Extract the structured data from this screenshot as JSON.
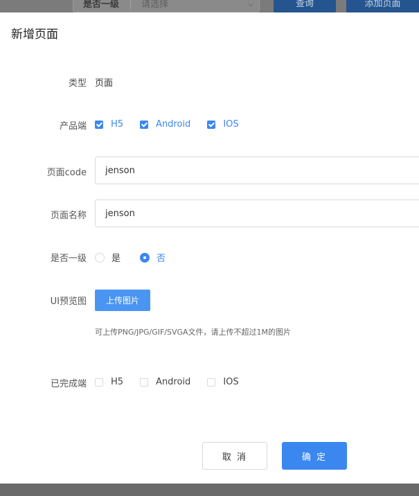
{
  "background": {
    "filter_label": "是否一级",
    "filter_placeholder": "请选择",
    "query_button": "查询",
    "add_button": "添加页面"
  },
  "modal": {
    "title": "新增页面",
    "type": {
      "label": "类型",
      "value": "页面"
    },
    "platforms": {
      "label": "产品端",
      "options": [
        {
          "label": "H5",
          "checked": true
        },
        {
          "label": "Android",
          "checked": true
        },
        {
          "label": "IOS",
          "checked": true
        }
      ]
    },
    "page_code": {
      "label": "页面code",
      "value": "jenson"
    },
    "page_name": {
      "label": "页面名称",
      "value": "jenson"
    },
    "is_top_level": {
      "label": "是否一级",
      "options": [
        {
          "label": "是",
          "checked": false
        },
        {
          "label": "否",
          "checked": true
        }
      ]
    },
    "ui_preview": {
      "label": "UI预览图",
      "upload_button": "上传图片",
      "hint": "可上传PNG/JPG/GIF/SVGA文件，请上传不超过1M的图片"
    },
    "completed_platforms": {
      "label": "已完成端",
      "options": [
        {
          "label": "H5",
          "checked": false
        },
        {
          "label": "Android",
          "checked": false
        },
        {
          "label": "IOS",
          "checked": false
        }
      ]
    },
    "cancel_button": "取 消",
    "ok_button": "确 定"
  },
  "colors": {
    "primary": "#3a87f0",
    "overlay": "#6f6f6f"
  }
}
